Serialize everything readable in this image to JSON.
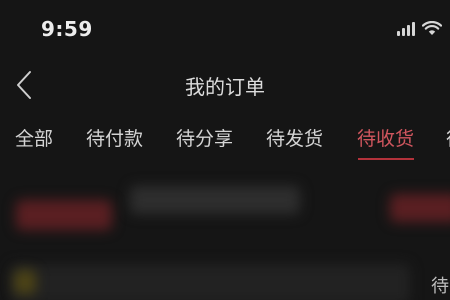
{
  "status_bar": {
    "time": "9:59"
  },
  "header": {
    "title": "我的订单",
    "back_icon": "chevron-left-icon"
  },
  "tabs": [
    {
      "label": "全部",
      "active": false
    },
    {
      "label": "待付款",
      "active": false
    },
    {
      "label": "待分享",
      "active": false
    },
    {
      "label": "待发货",
      "active": false
    },
    {
      "label": "待收货",
      "active": true
    },
    {
      "label": "待",
      "active": false
    }
  ],
  "content": {
    "card_status": "待"
  },
  "colors": {
    "background": "#151515",
    "active_tab": "#d0565e",
    "indicator": "#b3323b",
    "text": "#d9d9d9"
  }
}
